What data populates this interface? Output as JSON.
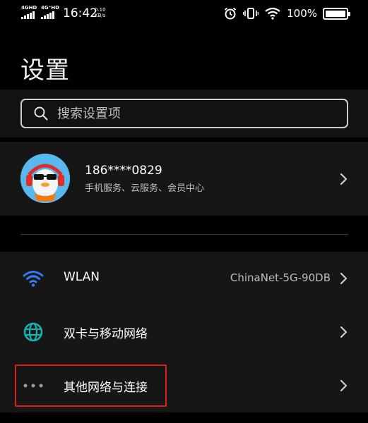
{
  "status_bar": {
    "sim1_network": "4GHD",
    "sim2_network": "4G⁺HD",
    "time": "16:42",
    "speed_value": "0.10",
    "speed_unit": "KB/s",
    "battery_percent": "100%"
  },
  "page": {
    "title": "设置"
  },
  "search": {
    "placeholder": "搜索设置项"
  },
  "account": {
    "phone": "186****0829",
    "services": "手机服务、云服务、会员中心"
  },
  "settings": {
    "items": [
      {
        "icon": "wifi-icon",
        "label": "WLAN",
        "value": "ChinaNet-5G-90DB"
      },
      {
        "icon": "globe-icon",
        "label": "双卡与移动网络",
        "value": ""
      },
      {
        "icon": "more-dots-icon",
        "label": "其他网络与连接",
        "value": ""
      }
    ]
  },
  "colors": {
    "background": "#000000",
    "card": "#161616",
    "wifi_icon": "#2f7cf6",
    "globe_icon": "#14b3b0",
    "highlight": "#e21b1b"
  }
}
